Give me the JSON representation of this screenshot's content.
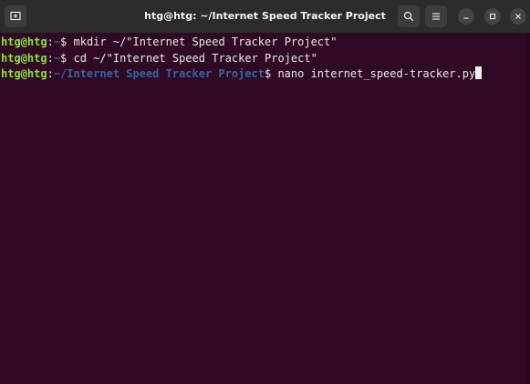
{
  "window": {
    "title": "htg@htg: ~/Internet Speed Tracker Project"
  },
  "icons": {
    "new_tab": "new-tab-icon",
    "search": "search-icon",
    "menu": "hamburger-menu-icon",
    "minimize": "minimize-icon",
    "maximize": "maximize-icon",
    "close": "close-icon"
  },
  "colors": {
    "background": "#300a24",
    "prompt_user": "#8ae234",
    "prompt_path": "#3465a4",
    "text": "#e0e0e0"
  },
  "terminal": {
    "lines": [
      {
        "user": "htg@htg",
        "sep": ":",
        "path": "~",
        "symbol": "$ ",
        "command": "mkdir ~/\"Internet Speed Tracker Project\""
      },
      {
        "user": "htg@htg",
        "sep": ":",
        "path": "~",
        "symbol": "$ ",
        "command": "cd ~/\"Internet Speed Tracker Project\""
      },
      {
        "user": "htg@htg",
        "sep": ":",
        "path": "~/Internet Speed Tracker Project",
        "symbol": "$ ",
        "command": "nano internet_speed-tracker.py"
      }
    ]
  }
}
